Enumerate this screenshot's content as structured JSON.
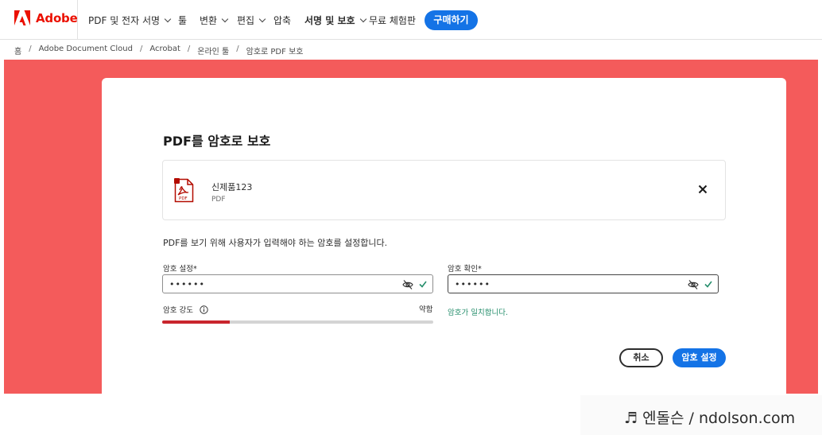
{
  "brand": {
    "name": "Adobe",
    "color": "#eb1000"
  },
  "nav": {
    "items": [
      {
        "label": "PDF 및 전자 서명",
        "dropdown": true
      },
      {
        "label": "툴",
        "dropdown": false
      },
      {
        "label": "변환",
        "dropdown": true
      },
      {
        "label": "편집",
        "dropdown": true
      },
      {
        "label": "압축",
        "dropdown": false
      },
      {
        "label": "서명 및 보호",
        "dropdown": true,
        "active": true
      },
      {
        "label": "무료 체험판",
        "dropdown": false
      }
    ],
    "buy_label": "구매하기"
  },
  "breadcrumb": [
    "홈",
    "Adobe Document Cloud",
    "Acrobat",
    "온라인 툴",
    "암호로 PDF 보호"
  ],
  "dialog": {
    "title": "PDF를 암호로 보호",
    "file": {
      "name": "신제품123",
      "type": "PDF",
      "icon": "pdf-file-icon"
    },
    "description": "PDF를 보기 위해 사용자가 입력해야 하는 암호를 설정합니다.",
    "password": {
      "label": "암호 설정*",
      "value": "••••••"
    },
    "confirm": {
      "label": "암호 확인*",
      "value": "••••••"
    },
    "strength": {
      "label": "암호 강도",
      "level_text": "약함",
      "fraction": 0.25
    },
    "match_text": "암호가 일치합니다.",
    "cancel_label": "취소",
    "submit_label": "암호 설정"
  },
  "colors": {
    "accent": "#1473e6",
    "background": "#f45b5b",
    "success": "#268e6c",
    "weak": "#c9252d"
  },
  "watermark": "♬ 엔돌슨 / ndolson.com"
}
